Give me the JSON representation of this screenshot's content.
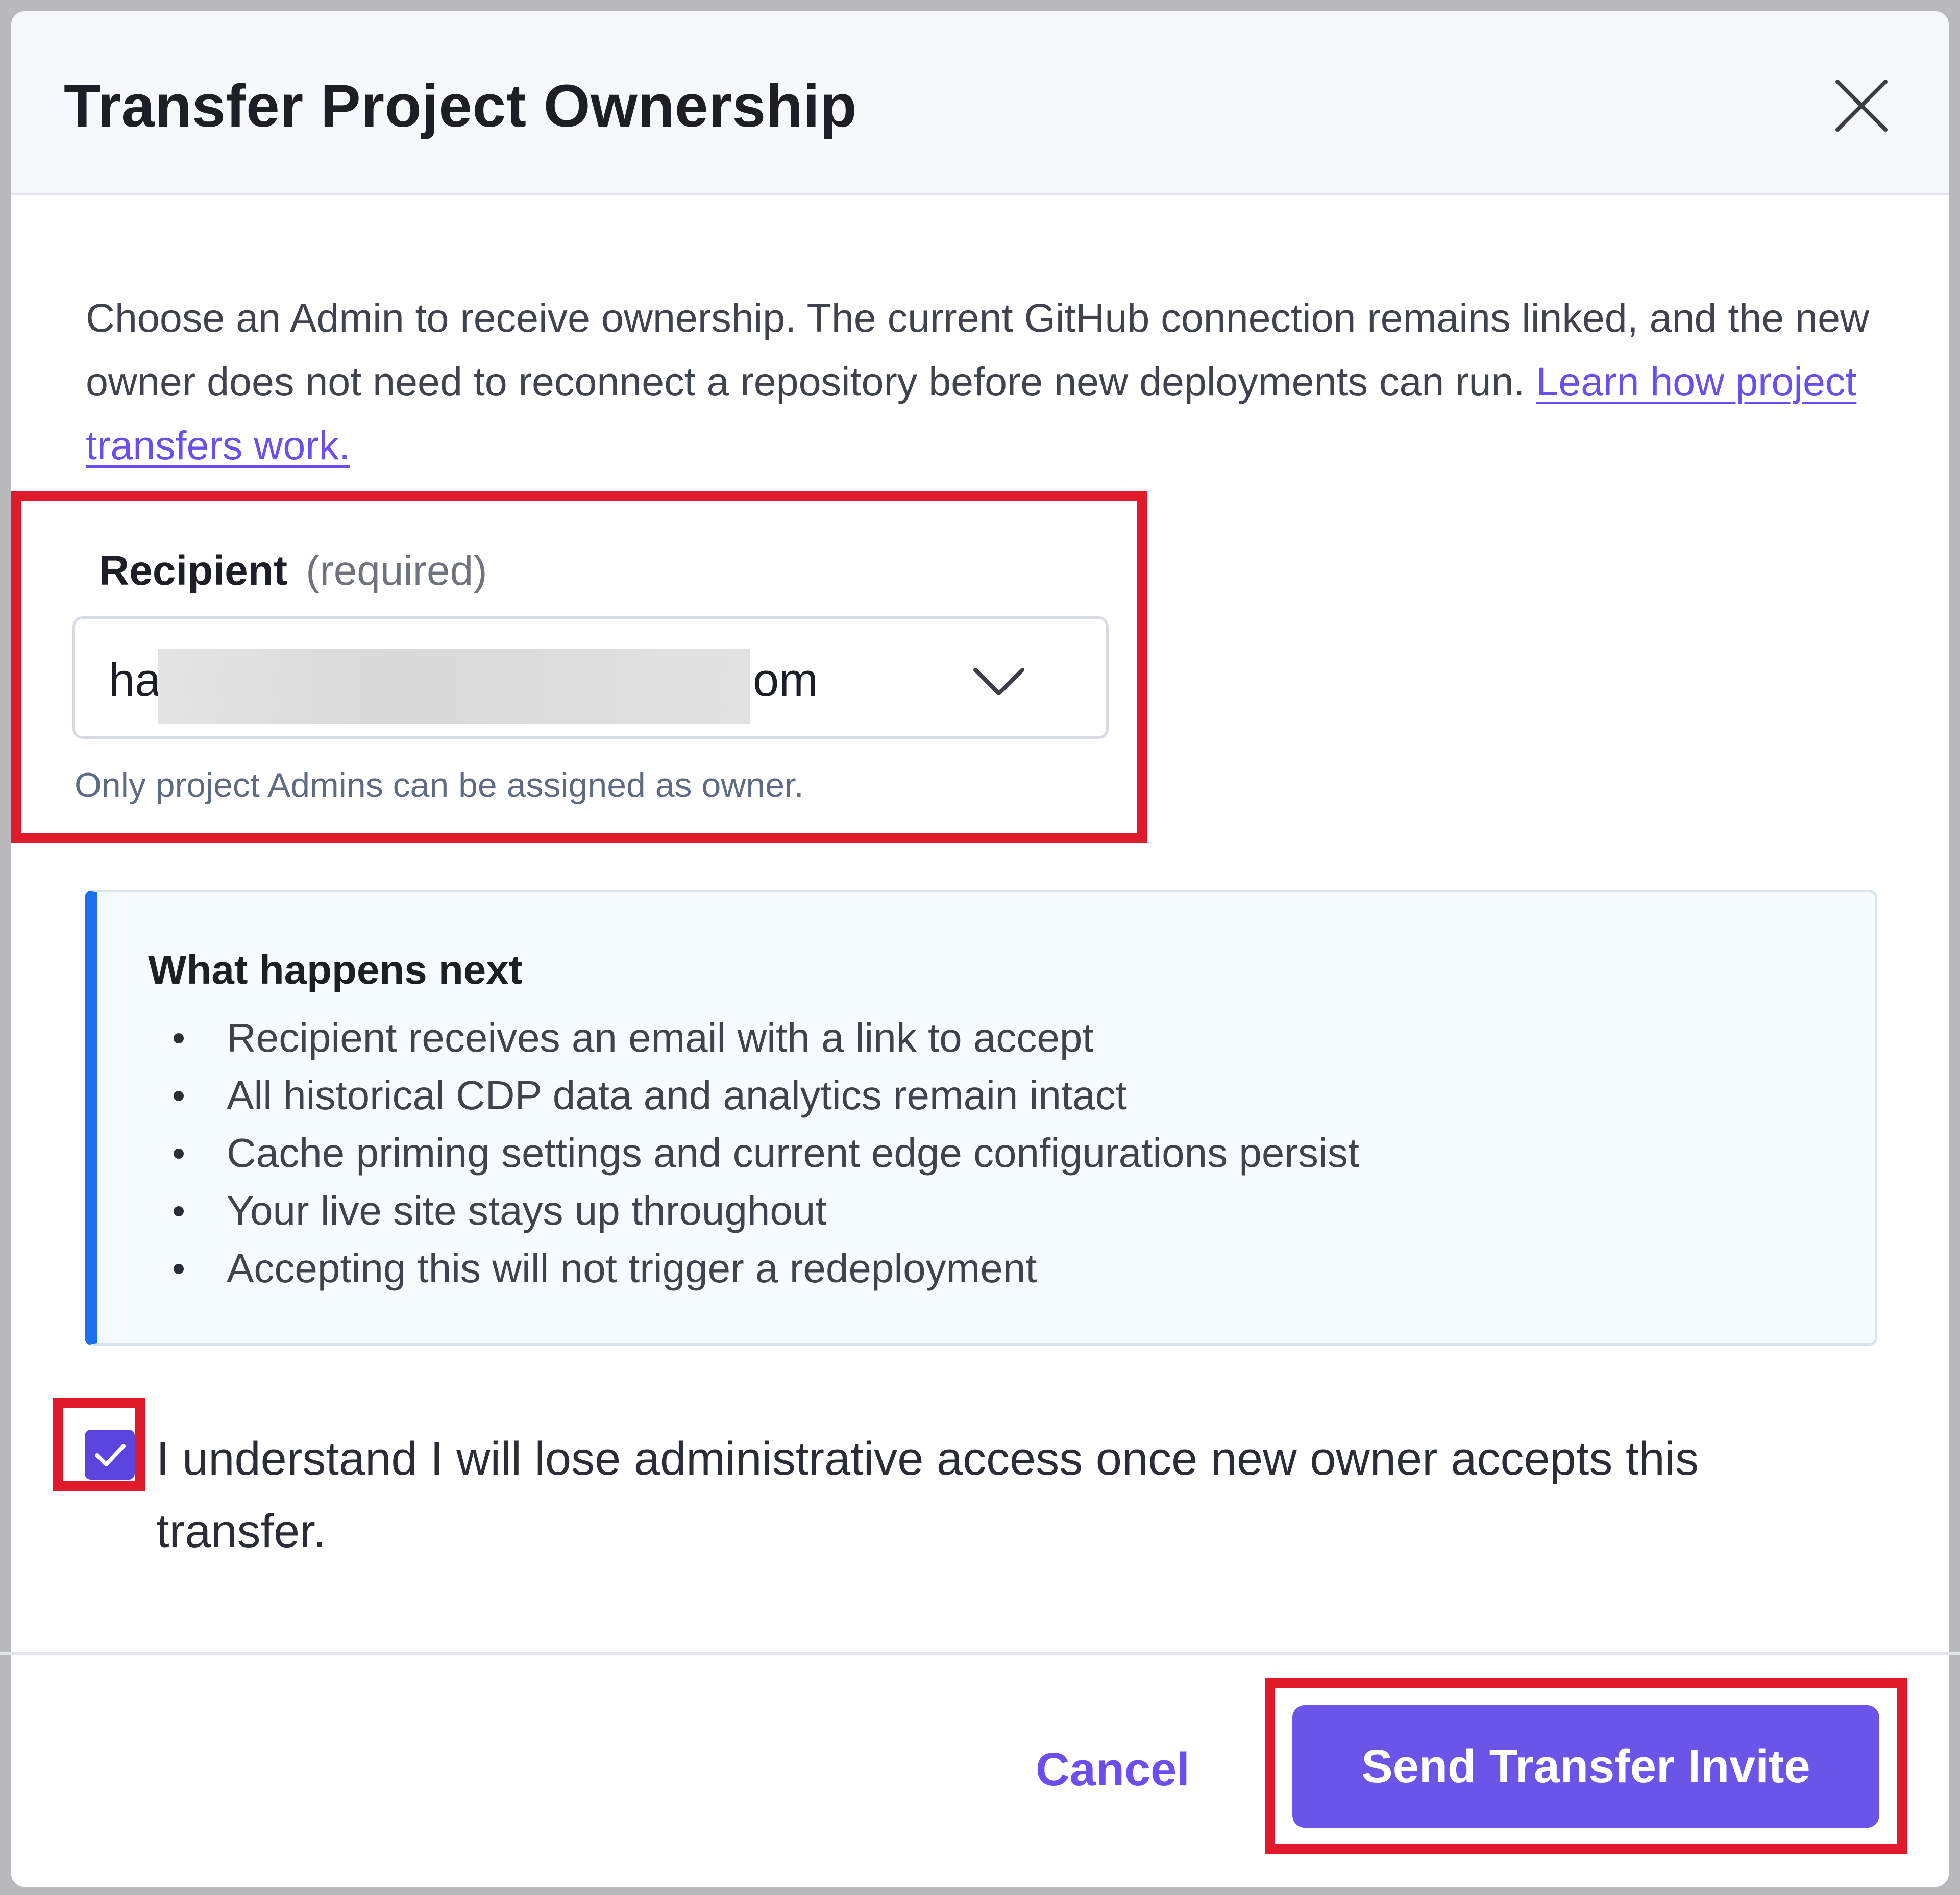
{
  "dialog": {
    "title": "Transfer Project Ownership",
    "close_icon": "close-icon"
  },
  "description": {
    "text": "Choose an Admin to receive ownership. The current GitHub connection remains linked, and the new owner does not need to reconnect a repository before new deployments can run.",
    "link": "Learn how project transfers work."
  },
  "recipient": {
    "label": "Recipient",
    "required": "(required)",
    "value_prefix": "ha",
    "value_suffix": "om",
    "hint": "Only project Admins can be assigned as owner.",
    "dropdown_icon": "chevron-down-icon"
  },
  "info": {
    "title": "What happens next",
    "items": [
      "Recipient receives an email with a link to accept",
      "All historical CDP data and analytics remain intact",
      "Cache priming settings and current edge configurations persist",
      "Your live site stays up throughout",
      "Accepting this will not trigger a redeployment"
    ]
  },
  "acknowledge": {
    "checked": true,
    "label": "I understand I will lose administrative access once new owner accepts this transfer."
  },
  "footer": {
    "cancel_label": "Cancel",
    "send_label": "Send Transfer Invite"
  },
  "colors": {
    "accent": "#6b55e8",
    "info_border": "#1d6ff0",
    "highlight": "#e0192b"
  }
}
